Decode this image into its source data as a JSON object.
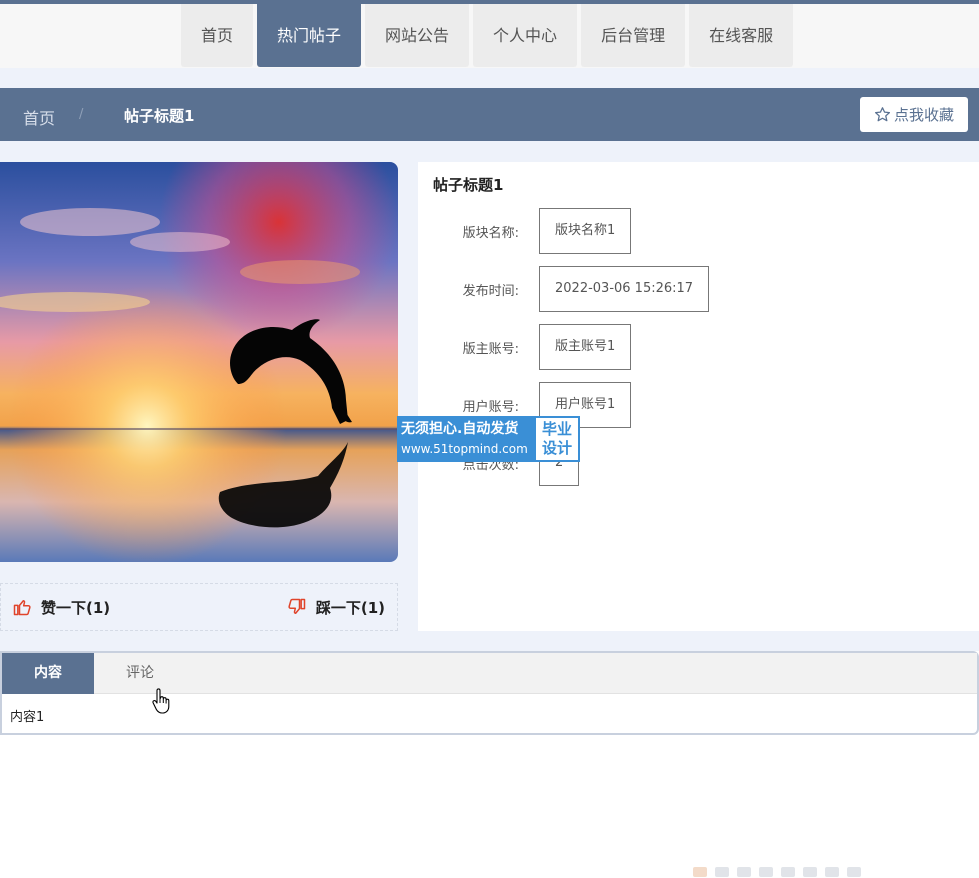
{
  "nav": {
    "items": [
      {
        "label": "首页"
      },
      {
        "label": "热门帖子"
      },
      {
        "label": "网站公告"
      },
      {
        "label": "个人中心"
      },
      {
        "label": "后台管理"
      },
      {
        "label": "在线客服"
      }
    ],
    "active_index": 1
  },
  "breadcrumb": {
    "home": "首页",
    "separator": "/",
    "current": "帖子标题1"
  },
  "favorite_button": {
    "label": "点我收藏",
    "icon": "star-outline-icon"
  },
  "post": {
    "title": "帖子标题1",
    "fields": [
      {
        "label": "版块名称:",
        "value": "版块名称1"
      },
      {
        "label": "发布时间:",
        "value": "2022-03-06 15:26:17"
      },
      {
        "label": "版主账号:",
        "value": "版主账号1"
      },
      {
        "label": "用户账号:",
        "value": "用户账号1"
      },
      {
        "label": "点击次数:",
        "value": "2"
      }
    ]
  },
  "votes": {
    "like_label": "赞一下(1)",
    "dislike_label": "踩一下(1)",
    "like_icon": "thumbs-up-icon",
    "dislike_icon": "thumbs-down-icon"
  },
  "watermark": {
    "line1": "无须担心.自动发货",
    "line2": "www.51topmind.com",
    "badge_line1": "毕业",
    "badge_line2": "设计"
  },
  "tabs": {
    "items": [
      {
        "label": "内容"
      },
      {
        "label": "评论"
      }
    ],
    "active_index": 0,
    "content": "内容1"
  },
  "colors": {
    "primary": "#5a7191",
    "background": "#eef2fa",
    "accent_red": "#e0442b",
    "watermark_blue": "#3a8fd6"
  }
}
